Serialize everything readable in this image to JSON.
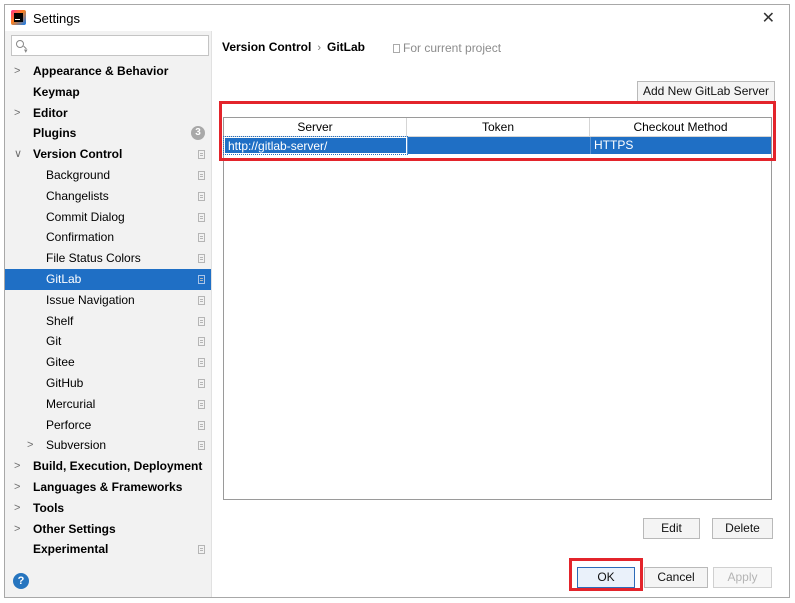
{
  "window": {
    "title": "Settings"
  },
  "search": {
    "placeholder": ""
  },
  "sidebar": {
    "items": [
      {
        "label": "Appearance & Behavior",
        "arrow": ">",
        "bold": true,
        "indent": 0
      },
      {
        "label": "Keymap",
        "bold": true,
        "indent": 0
      },
      {
        "label": "Editor",
        "arrow": ">",
        "bold": true,
        "indent": 0
      },
      {
        "label": "Plugins",
        "bold": true,
        "indent": 0,
        "badge": "3"
      },
      {
        "label": "Version Control",
        "arrow": "∨",
        "bold": true,
        "indent": 0,
        "project": true
      },
      {
        "label": "Background",
        "indent": 1,
        "project": true
      },
      {
        "label": "Changelists",
        "indent": 1,
        "project": true
      },
      {
        "label": "Commit Dialog",
        "indent": 1,
        "project": true
      },
      {
        "label": "Confirmation",
        "indent": 1,
        "project": true
      },
      {
        "label": "File Status Colors",
        "indent": 1,
        "project": true
      },
      {
        "label": "GitLab",
        "indent": 1,
        "project": true,
        "selected": true
      },
      {
        "label": "Issue Navigation",
        "indent": 1,
        "project": true
      },
      {
        "label": "Shelf",
        "indent": 1,
        "project": true
      },
      {
        "label": "Git",
        "indent": 1,
        "project": true
      },
      {
        "label": "Gitee",
        "indent": 1,
        "project": true
      },
      {
        "label": "GitHub",
        "indent": 1,
        "project": true
      },
      {
        "label": "Mercurial",
        "indent": 1,
        "project": true
      },
      {
        "label": "Perforce",
        "indent": 1,
        "project": true
      },
      {
        "label": "Subversion",
        "arrow": ">",
        "indent": 1,
        "project": true
      },
      {
        "label": "Build, Execution, Deployment",
        "arrow": ">",
        "bold": true,
        "indent": 0
      },
      {
        "label": "Languages & Frameworks",
        "arrow": ">",
        "bold": true,
        "indent": 0
      },
      {
        "label": "Tools",
        "arrow": ">",
        "bold": true,
        "indent": 0
      },
      {
        "label": "Other Settings",
        "arrow": ">",
        "bold": true,
        "indent": 0
      },
      {
        "label": "Experimental",
        "bold": true,
        "indent": 0,
        "project": true
      }
    ]
  },
  "breadcrumb": {
    "parent": "Version Control",
    "separator": "›",
    "current": "GitLab"
  },
  "scope": {
    "label": "For current project"
  },
  "buttons": {
    "add_server": "Add New GitLab Server",
    "edit": "Edit",
    "delete": "Delete",
    "ok": "OK",
    "cancel": "Cancel",
    "apply": "Apply"
  },
  "table": {
    "columns": [
      "Server",
      "Token",
      "Checkout Method"
    ],
    "rows": [
      {
        "server": "http://gitlab-server/",
        "token": "",
        "checkout_method": "HTTPS"
      }
    ]
  },
  "help": {
    "label": "?"
  },
  "colors": {
    "selection": "#1f6fc5",
    "highlight": "#e3242b",
    "sidebar_bg": "#f2f2f2"
  }
}
